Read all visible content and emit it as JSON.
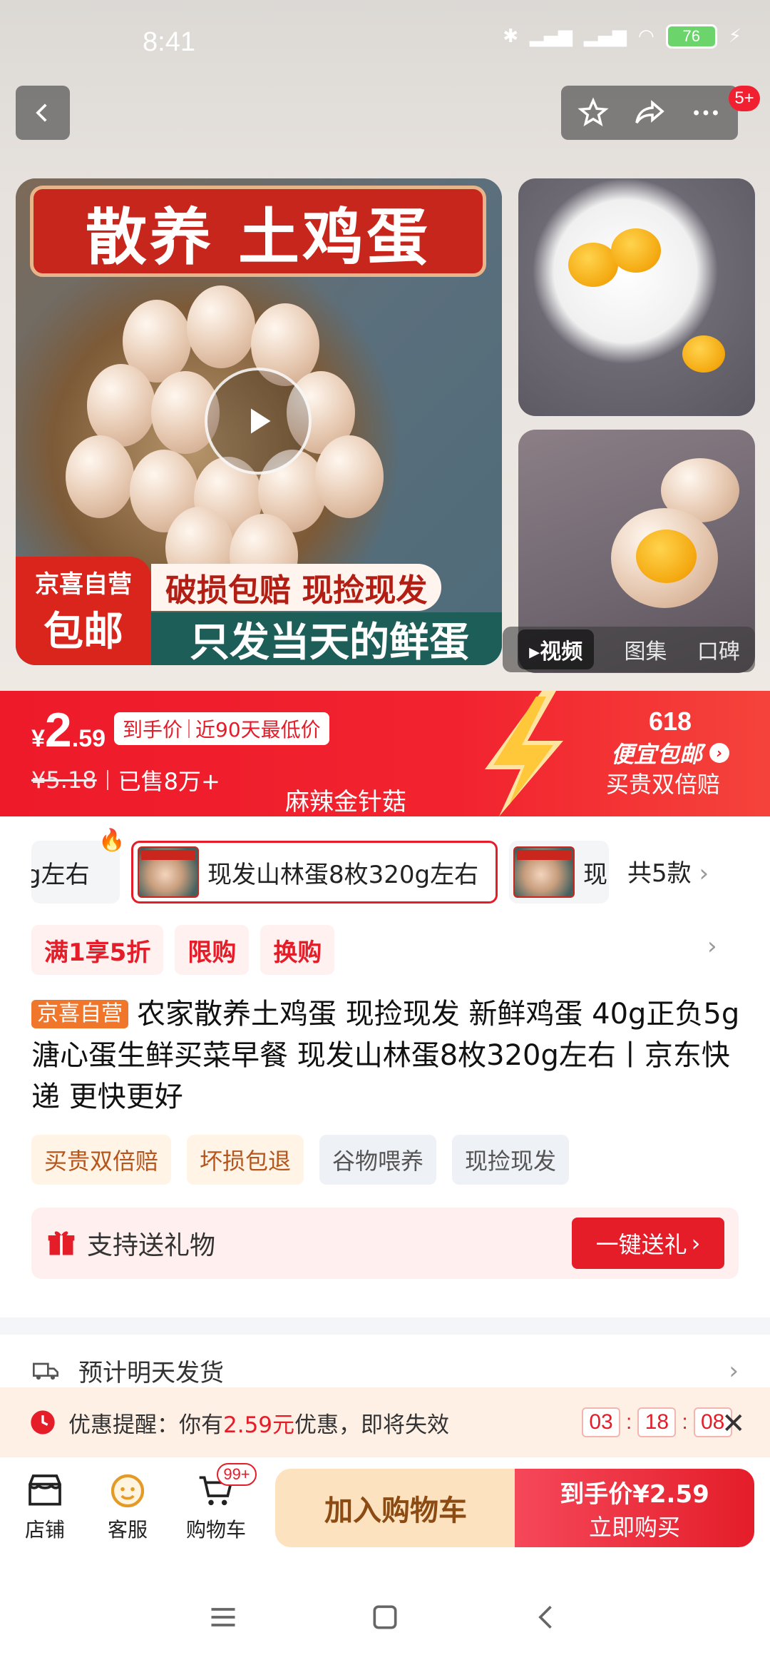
{
  "status_bar": {
    "time": "8:41",
    "battery": "76"
  },
  "header": {
    "more_badge": "5+"
  },
  "gallery": {
    "main_title": "散养 土鸡蛋",
    "promo_line1": "破损包赔 现捡现发",
    "promo_line2": "只发当天的鲜蛋",
    "badge_line1": "京喜自营",
    "badge_line2": "包邮",
    "tabs": [
      "视频",
      "图集",
      "口碑"
    ]
  },
  "price": {
    "currency": "¥",
    "integer": "2",
    "decimal": ".59",
    "tag_left": "到手价",
    "tag_right": "近90天最低价",
    "original": "¥5.18",
    "sold": "已售8万+",
    "subline": "麻辣金针菇",
    "event_line1": "618",
    "event_line2": "便宜包邮",
    "event_line3": "买贵双倍赔"
  },
  "variants": {
    "items": [
      "g左右",
      "现发山林蛋8枚320g左右",
      "现"
    ],
    "total": "共5款"
  },
  "promo_chips": [
    "满1享5折",
    "限购",
    "换购"
  ],
  "product": {
    "badge": "京喜自营",
    "title": "农家散养土鸡蛋 现捡现发 新鲜鸡蛋 40g正负5g溏心蛋生鲜买菜早餐 现发山林蛋8枚320g左右丨京东快递 更快更好"
  },
  "tags": [
    "买贵双倍赔",
    "坏损包退",
    "谷物喂养",
    "现捡现发"
  ],
  "gift": {
    "label": "支持送礼物",
    "button": "一键送礼"
  },
  "shipping": {
    "text": "预计明天发货"
  },
  "reminder": {
    "prefix": "优惠提醒：你有",
    "amount": "2.59元",
    "suffix": "优惠，即将失效",
    "hours": "03",
    "minutes": "18",
    "seconds": "08"
  },
  "bottom_bar": {
    "store": "店铺",
    "service": "客服",
    "cart": "购物车",
    "cart_badge": "99+",
    "add_to_cart": "加入购物车",
    "buy_line1": "到手价¥2.59",
    "buy_line2": "立即购买"
  },
  "colors": {
    "accent": "#e41d29",
    "orange": "#f0762c",
    "cart_button": "#fde2c0"
  }
}
